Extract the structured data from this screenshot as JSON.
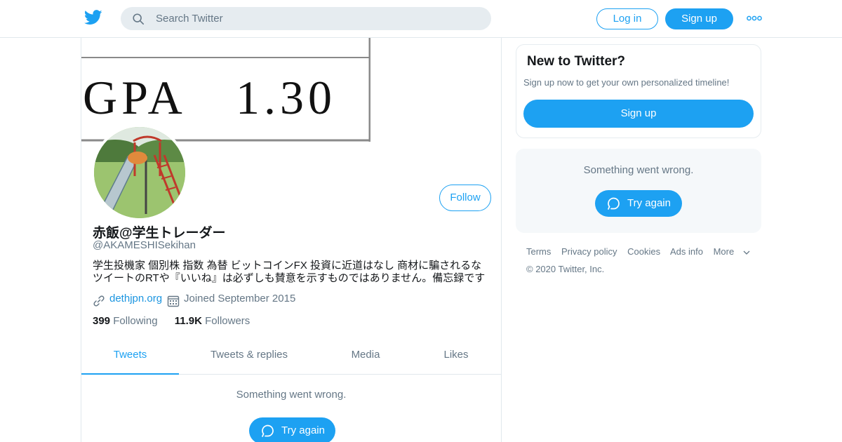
{
  "header": {
    "search_placeholder": "Search Twitter",
    "login_label": "Log in",
    "signup_label": "Sign up"
  },
  "banner": {
    "text": "GPA　1.30"
  },
  "profile": {
    "display_name": "赤飯@学生トレーダー",
    "handle": "@AKAMESHISekihan",
    "bio_line1": "学生投機家 個別株 指数 為替 ビットコインFX 投資に近道はなし 商材に騙されるな",
    "bio_line2": "ツイートのRTや『いいね』は必ずしも賛意を示すものではありません。備忘録です",
    "website": "dethjpn.org",
    "joined": "Joined September 2015",
    "following_count": "399",
    "following_label": "Following",
    "followers_count": "11.9K",
    "followers_label": "Followers",
    "follow_label": "Follow"
  },
  "tabs": [
    {
      "label": "Tweets"
    },
    {
      "label": "Tweets & replies"
    },
    {
      "label": "Media"
    },
    {
      "label": "Likes"
    }
  ],
  "timeline": {
    "error": "Something went wrong.",
    "retry_label": "Try again"
  },
  "sidebar": {
    "new_title": "New to Twitter?",
    "new_text": "Sign up now to get your own personalized timeline!",
    "signup_label": "Sign up",
    "error": "Something went wrong.",
    "retry_label": "Try again"
  },
  "footer": {
    "links": [
      "Terms",
      "Privacy policy",
      "Cookies",
      "Ads info",
      "More"
    ],
    "copyright": "© 2020 Twitter, Inc."
  },
  "colors": {
    "accent": "#1da1f2",
    "muted": "#657786",
    "text": "#14171a"
  }
}
